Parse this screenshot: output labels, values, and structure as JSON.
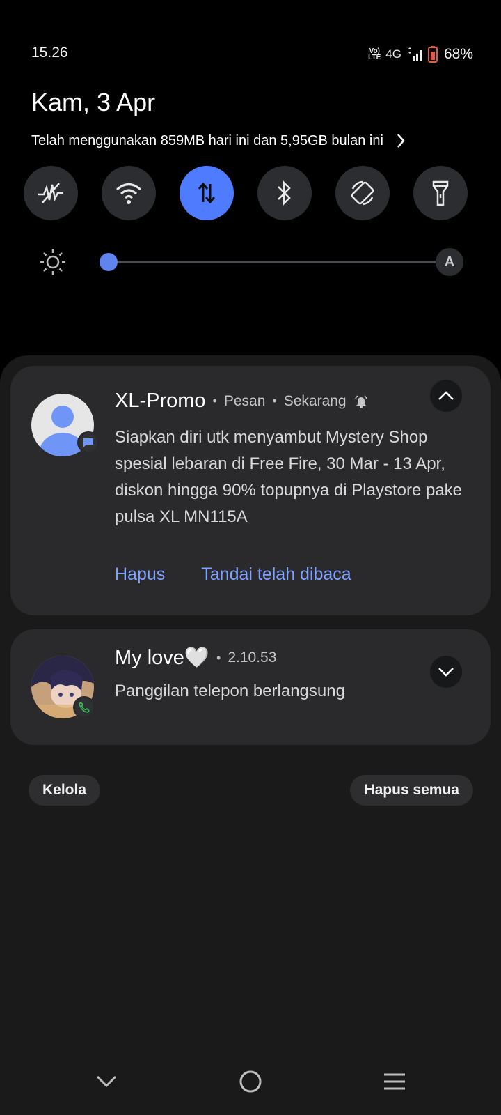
{
  "status_bar": {
    "time": "15.26",
    "volte_label": "Vo) LTE",
    "network_type": "4G",
    "battery_percent": "68%",
    "battery_level": 0.68,
    "signal_icon": "signal-bars-icon",
    "battery_icon": "battery-icon"
  },
  "header": {
    "date": "Kam, 3 Apr",
    "data_usage": "Telah menggunakan 859MB hari ini dan 5,95GB bulan ini"
  },
  "quick_toggles": [
    {
      "name": "mobile-hotspot",
      "icon": "hotspot-off-icon",
      "active": false
    },
    {
      "name": "wifi",
      "icon": "wifi-icon",
      "active": false
    },
    {
      "name": "mobile-data",
      "icon": "mobile-data-icon",
      "active": true
    },
    {
      "name": "bluetooth",
      "icon": "bluetooth-icon",
      "active": false
    },
    {
      "name": "auto-rotate",
      "icon": "rotate-icon",
      "active": false
    },
    {
      "name": "flashlight",
      "icon": "flashlight-icon",
      "active": false
    }
  ],
  "brightness": {
    "level": 0.02,
    "auto_label": "A"
  },
  "notifications": [
    {
      "app_title": "XL-Promo",
      "category": "Pesan",
      "time": "Sekarang",
      "body": "Siapkan diri utk menyambut Mystery Shop spesial lebaran di Free Fire, 30 Mar - 13 Apr, diskon hingga 90% topupnya di Playstore pake pulsa XL MN115A",
      "actions": [
        "Hapus",
        "Tandai telah dibaca"
      ],
      "expanded": true
    },
    {
      "app_title": "My love🤍",
      "time": "2.10.53",
      "body": "Panggilan telepon berlangsung",
      "expanded": false
    }
  ],
  "footer": {
    "manage_label": "Kelola",
    "clear_all_label": "Hapus semua"
  },
  "colors": {
    "accent": "#4f7cff",
    "action_text": "#7fa1ff",
    "card_bg": "#2a2a2c",
    "panel_bg": "#1a1a1a"
  }
}
